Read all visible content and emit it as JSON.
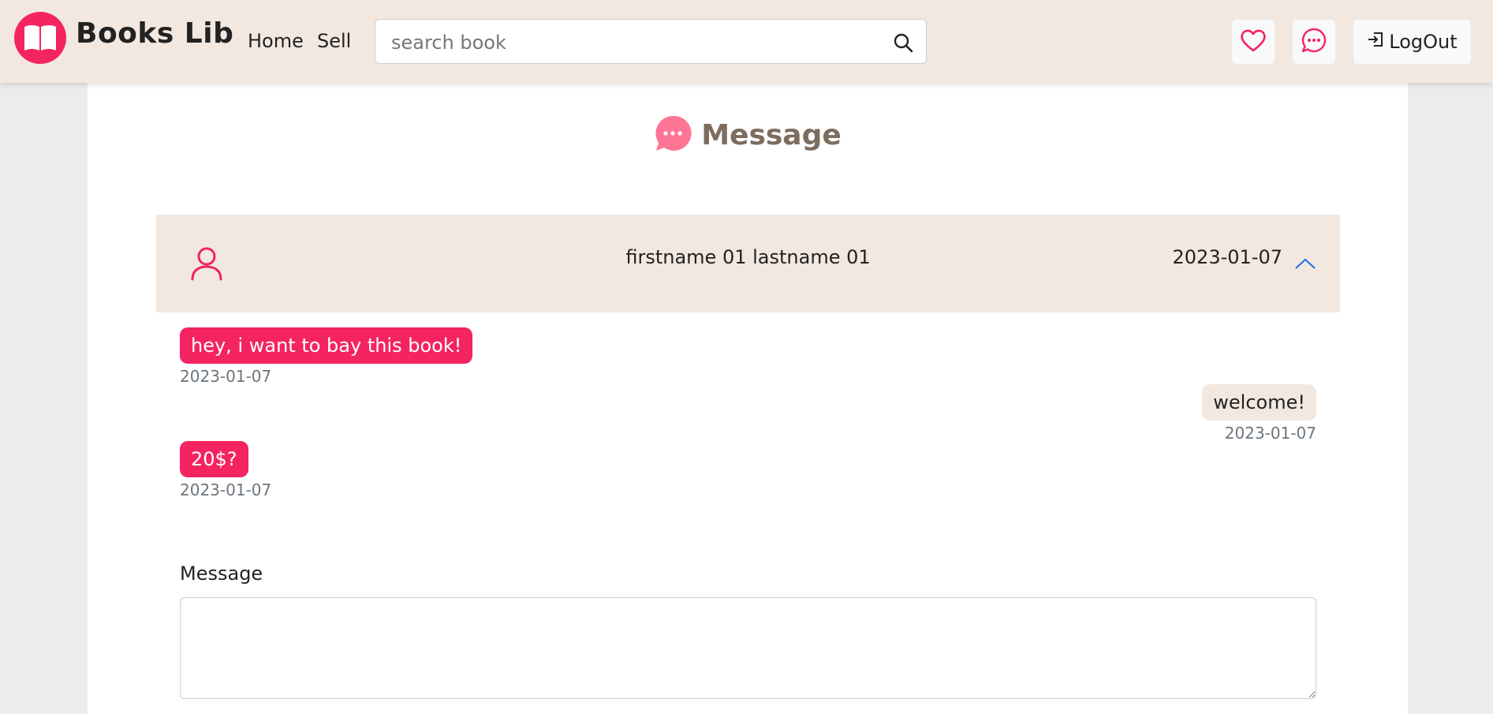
{
  "app": {
    "brand": "Books Lib"
  },
  "nav": {
    "home": "Home",
    "sell": "Sell"
  },
  "search": {
    "placeholder": "search book",
    "value": ""
  },
  "header_buttons": {
    "logout": "LogOut"
  },
  "page": {
    "title": "Message"
  },
  "conversation": {
    "name": "firstname 01 lastname 01",
    "date": "2023-01-07",
    "messages": [
      {
        "text": "hey, i want to bay this book!",
        "date": "2023-01-07",
        "direction": "in"
      },
      {
        "text": "welcome!",
        "date": "2023-01-07",
        "direction": "out"
      },
      {
        "text": "20$?",
        "date": "2023-01-07",
        "direction": "in"
      }
    ]
  },
  "compose": {
    "label": "Message",
    "value": ""
  },
  "colors": {
    "accent": "#f42461",
    "navbar": "#f3e8e0",
    "title": "#7c6d5e"
  },
  "icons": [
    "book-icon",
    "search-icon",
    "heart-icon",
    "chat-icon",
    "logout-icon",
    "user-icon",
    "chevron-up-icon"
  ]
}
